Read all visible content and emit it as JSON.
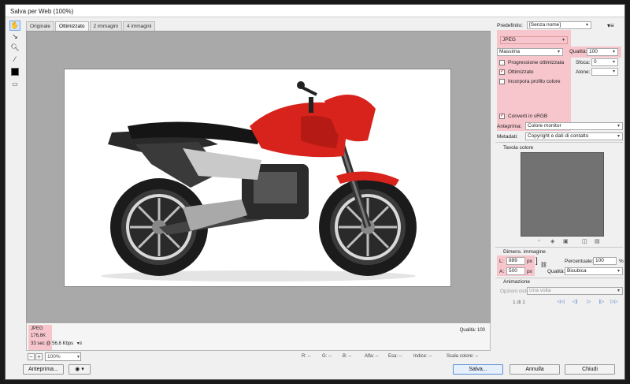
{
  "window": {
    "title": "Salva per Web (100%)"
  },
  "toolbar": {
    "tools": [
      "hand-tool-icon",
      "slice-select-icon",
      "zoom-icon",
      "eyedropper-icon"
    ]
  },
  "tabs": [
    {
      "label": "Originale"
    },
    {
      "label": "Ottimizzato"
    },
    {
      "label": "2 immagini"
    },
    {
      "label": "4 immagini"
    }
  ],
  "info": {
    "format": "JPEG",
    "size": "176,6K",
    "time": "33 sec @ 56,6 Kbps",
    "quality": "Qualità: 100"
  },
  "status": {
    "zoom": "100%",
    "r": "R: --",
    "g": "G: --",
    "b": "B: --",
    "alpha": "Alfa: --",
    "hex": "Esa: --",
    "index": "Indice: --",
    "color_scale": "Scala colore: --"
  },
  "buttons": {
    "preview": "Anteprima...",
    "save": "Salva...",
    "cancel": "Annulla",
    "done": "Chiudi"
  },
  "panel": {
    "preset_label": "Predefinito:",
    "preset_value": "[Senza nome]",
    "format_value": "JPEG",
    "quality_preset": "Massima",
    "quality_label": "Qualità:",
    "quality_value": "100",
    "progressive_label": "Progressione ottimizzata",
    "blur_label": "Sfoca:",
    "blur_value": "0",
    "optimized_label": "Ottimizzato",
    "matte_label": "Alone:",
    "embed_profile_label": "Incorpora profilo colore",
    "convert_srgb_label": "Converti in sRGB",
    "preview_label": "Anteprima:",
    "preview_value": "Colore monitor",
    "metadata_label": "Metadati:",
    "metadata_value": "Copyright e dati di contatto",
    "color_table_label": "Tavola colore",
    "image_size_label": "Dimens. immagine",
    "width_label": "L:",
    "width_value": "889",
    "height_label": "A:",
    "height_value": "500",
    "unit_px": "px",
    "percent_label": "Percentuale:",
    "percent_value": "100",
    "percent_sign": "%",
    "resample_label": "Qualità:",
    "resample_value": "Bicubica",
    "animation_label": "Animazione",
    "loop_label": "Opzioni ciclo:",
    "loop_value": "Una volta",
    "frame_counter": "1 di 1"
  },
  "colors": {
    "highlight": "#f6c6cc",
    "bike_red": "#d8231c"
  }
}
